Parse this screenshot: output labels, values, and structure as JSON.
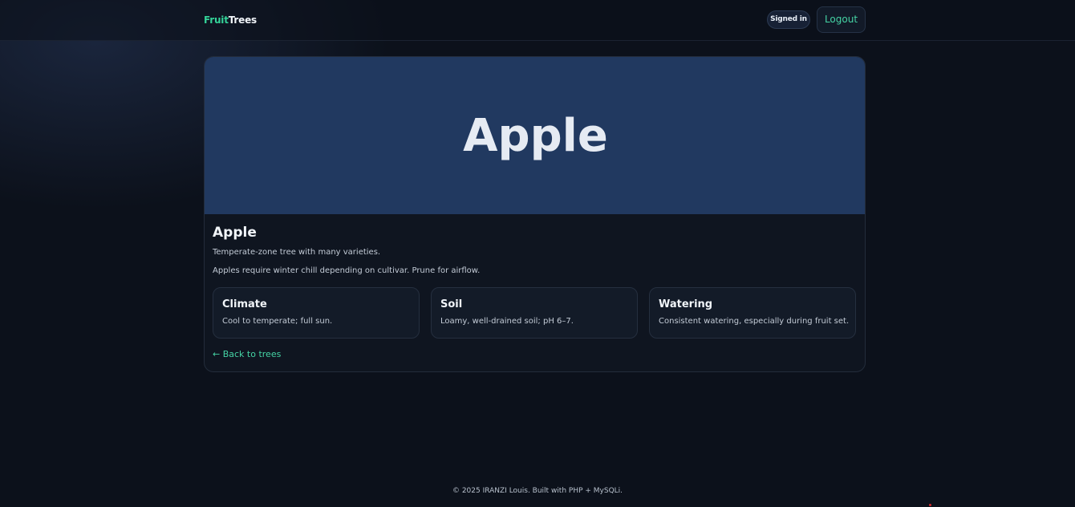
{
  "header": {
    "brand_part1": "Fruit",
    "brand_part2": "Trees",
    "signed_in_label": "Signed in",
    "logout_label": "Logout"
  },
  "tree": {
    "hero_title": "Apple",
    "name": "Apple",
    "summary": "Temperate-zone tree with many varieties.",
    "description": "Apples require winter chill depending on cultivar. Prune for airflow.",
    "info": [
      {
        "title": "Climate",
        "text": "Cool to temperate; full sun."
      },
      {
        "title": "Soil",
        "text": "Loamy, well-drained soil; pH 6–7."
      },
      {
        "title": "Watering",
        "text": "Consistent watering, especially during fruit set."
      }
    ],
    "back_link": "← Back to trees"
  },
  "footer": {
    "text": "© 2025 IRANZI Louis. Built with PHP + MySQLi."
  },
  "colors": {
    "background": "#0c111b",
    "accent": "#45d3a4",
    "hero": "#213960",
    "card": "#0f1520"
  }
}
